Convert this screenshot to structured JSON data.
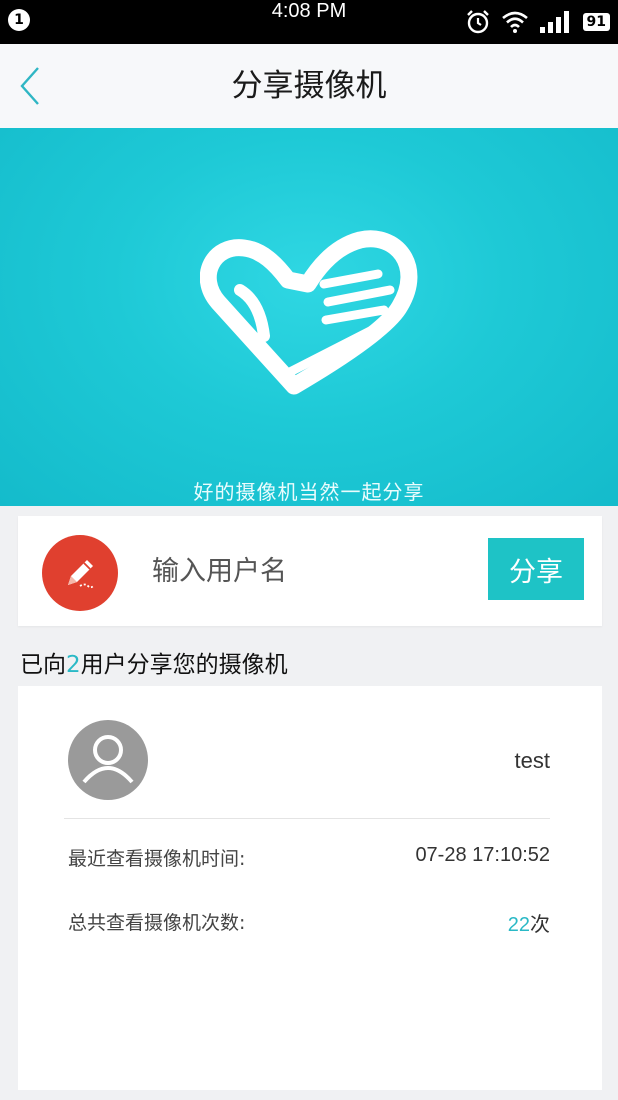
{
  "status_bar": {
    "notification_count": "1",
    "time": "4:08 PM",
    "battery": "91",
    "icons": [
      "alarm-icon",
      "wifi-icon",
      "signal-icon",
      "battery-icon"
    ]
  },
  "header": {
    "title": "分享摄像机",
    "back_icon": "chevron-left-icon"
  },
  "banner": {
    "slogan": "好的摄像机当然一起分享",
    "icon": "heart-hand-icon",
    "color": "#1ec9d6"
  },
  "share": {
    "icon": "pencil-icon",
    "input_placeholder": "输入用户名",
    "input_value": "",
    "button_label": "分享",
    "accent_color": "#1ec3c6",
    "icon_bg_color": "#e0402f"
  },
  "shared_section": {
    "prefix": "已向",
    "count": "2",
    "suffix": "用户分享您的摄像机"
  },
  "shared_users": [
    {
      "name": "test",
      "avatar_icon": "user-avatar-icon",
      "last_view_label": "最近查看摄像机时间:",
      "last_view_value": "07-28 17:10:52",
      "total_views_label": "总共查看摄像机次数:",
      "total_views_count": "22",
      "total_views_unit": "次"
    }
  ]
}
